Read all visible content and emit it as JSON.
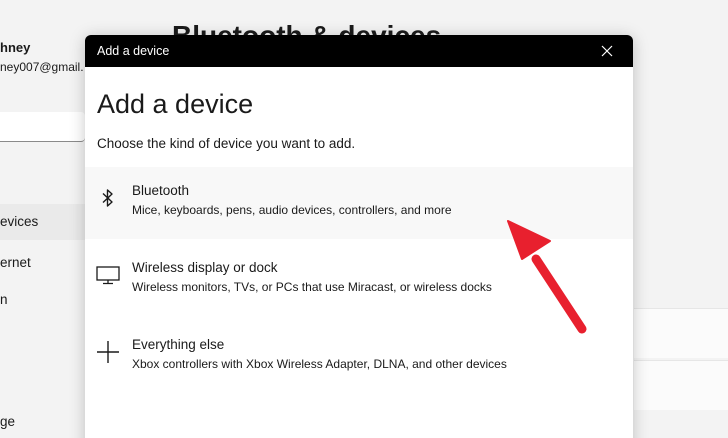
{
  "background": {
    "user_name": "hney",
    "user_email": "ney007@gmail.",
    "page_title": "Bluetooth & devices",
    "nav_items": [
      "evices",
      "ernet",
      "n",
      "ge"
    ]
  },
  "dialog": {
    "titlebar_text": "Add a device",
    "heading": "Add a device",
    "subtitle": "Choose the kind of device you want to add.",
    "options": [
      {
        "title": "Bluetooth",
        "description": "Mice, keyboards, pens, audio devices, controllers, and more",
        "icon": "bluetooth-icon"
      },
      {
        "title": "Wireless display or dock",
        "description": "Wireless monitors, TVs, or PCs that use Miracast, or wireless docks",
        "icon": "monitor-icon"
      },
      {
        "title": "Everything else",
        "description": "Xbox controllers with Xbox Wireless Adapter, DLNA, and other devices",
        "icon": "plus-icon"
      }
    ]
  },
  "annotation": {
    "arrow_color": "#e8202e",
    "arrow_target": "Bluetooth"
  },
  "colors": {
    "titlebar": "#000000",
    "dialog_bg": "#ffffff",
    "page_bg": "#f3f3f3",
    "highlight_row": "#f8f8f8"
  }
}
